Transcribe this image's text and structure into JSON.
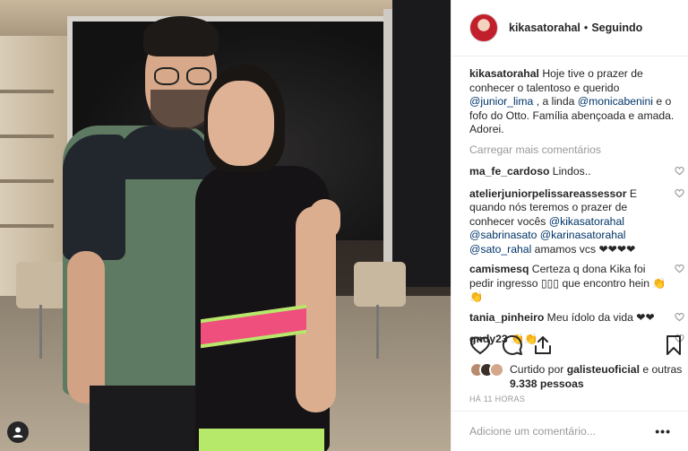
{
  "post": {
    "author": "kikasatorahal",
    "separator": "•",
    "follow_status": "Seguindo",
    "caption_user": "kikasatorahal",
    "caption_parts": [
      {
        "text": " Hoje tive o prazer de conhecer o talentoso e querido ",
        "mention": false
      },
      {
        "text": "@junior_lima",
        "mention": true
      },
      {
        "text": " , a linda ",
        "mention": false
      },
      {
        "text": "@monicabenini",
        "mention": true
      },
      {
        "text": " e o fofo do Otto. Família abençoada e amada. Adorei.",
        "mention": false
      }
    ],
    "load_more": "Carregar mais comentários",
    "comments": [
      {
        "user": "ma_fe_cardoso",
        "parts": [
          {
            "text": " Lindos..",
            "mention": false
          }
        ]
      },
      {
        "user": "atelierjuniorpelissareassessor",
        "parts": [
          {
            "text": " E quando nós teremos o prazer de conhecer vocês ",
            "mention": false
          },
          {
            "text": "@kikasatorahal",
            "mention": true
          },
          {
            "text": " ",
            "mention": false
          },
          {
            "text": "@sabrinasato",
            "mention": true
          },
          {
            "text": " ",
            "mention": false
          },
          {
            "text": "@karinasatorahal",
            "mention": true
          },
          {
            "text": " ",
            "mention": false
          },
          {
            "text": "@sato_rahal",
            "mention": true
          },
          {
            "text": " amamos vcs ❤❤❤❤",
            "mention": false
          }
        ]
      },
      {
        "user": "camismesq",
        "parts": [
          {
            "text": " Certeza q dona Kika foi pedir ingresso ▯▯▯ que encontro hein 👏👏",
            "mention": false
          }
        ]
      },
      {
        "user": "tania_pinheiro",
        "parts": [
          {
            "text": " Meu ídolo da vida ❤❤",
            "mention": false
          }
        ]
      },
      {
        "user": "gndy23",
        "parts": [
          {
            "text": " 👏👏",
            "mention": false
          }
        ]
      }
    ],
    "liked_by_prefix": "Curtido por ",
    "liked_by_user": "galisteuoficial",
    "liked_by_mid": " e outras ",
    "liked_by_count": "9.338 pessoas",
    "time_ago": "HÁ 11 HORAS",
    "add_comment_placeholder": "Adicione um comentário...",
    "more_glyph": "•••"
  },
  "icons": {
    "like": "heart-icon",
    "comment": "comment-icon",
    "share": "share-icon",
    "save": "bookmark-icon",
    "small_like": "small-heart-icon",
    "tag": "user-tag-icon"
  }
}
